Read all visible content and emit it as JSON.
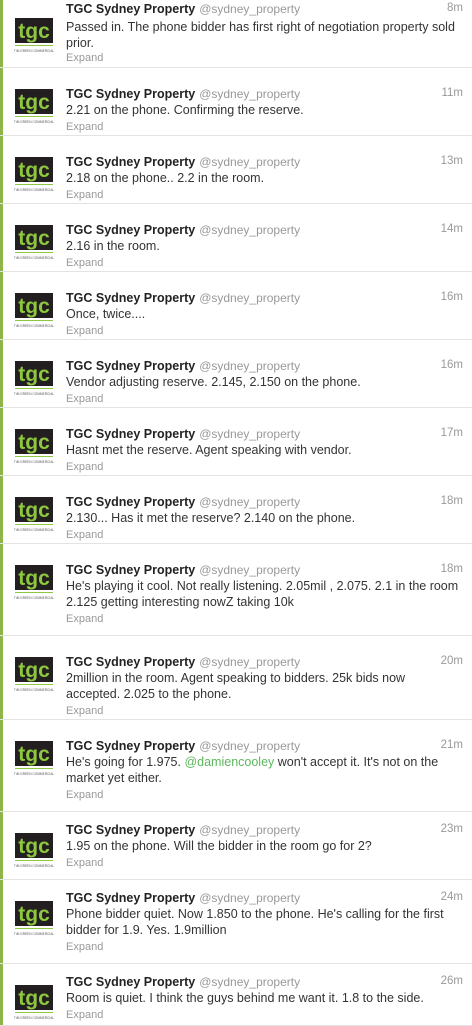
{
  "account": {
    "name": "TGC Sydney Property",
    "handle": "@sydney_property",
    "logo_text": "tgc",
    "logo_subtext": "TIM GREEN COMMERCIAL"
  },
  "expand_label": "Expand",
  "colors": {
    "logo_green": "#8dc63f",
    "logo_dark": "#231f20",
    "mention": "#5cb85c"
  },
  "tweets": [
    {
      "time": "8m",
      "text": "Passed in. The phone bidder has first right of negotiation property sold prior."
    },
    {
      "time": "11m",
      "text": "2.21 on the phone. Confirming the reserve."
    },
    {
      "time": "13m",
      "text": "2.18 on the phone.. 2.2 in the room."
    },
    {
      "time": "14m",
      "text": "2.16 in the room."
    },
    {
      "time": "16m",
      "text": "Once, twice...."
    },
    {
      "time": "16m",
      "text": "Vendor adjusting reserve. 2.145, 2.150 on the phone."
    },
    {
      "time": "17m",
      "text": "Hasnt met the reserve. Agent speaking with vendor."
    },
    {
      "time": "18m",
      "text": "2.130... Has it met the reserve? 2.140 on the phone."
    },
    {
      "time": "18m",
      "text": "He's playing it cool. Not really listening. 2.05mil , 2.075. 2.1 in the room 2.125 getting interesting nowZ taking 10k"
    },
    {
      "time": "20m",
      "text": "2million in the room. Agent speaking to bidders. 25k bids now accepted. 2.025 to the phone."
    },
    {
      "time": "21m",
      "text_before": "He's going for 1.975.",
      "mention": "@damiencooley",
      "text_after": "won't accept it. It's not on the market yet either."
    },
    {
      "time": "23m",
      "text": "1.95 on the phone. Will the bidder in the room go for 2?"
    },
    {
      "time": "24m",
      "text": "Phone bidder quiet. Now 1.850 to the phone. He's calling for the first bidder for 1.9. Yes. 1.9million"
    },
    {
      "time": "26m",
      "text": "Room is quiet. I think the guys behind me want it. 1.8 to the side."
    }
  ]
}
